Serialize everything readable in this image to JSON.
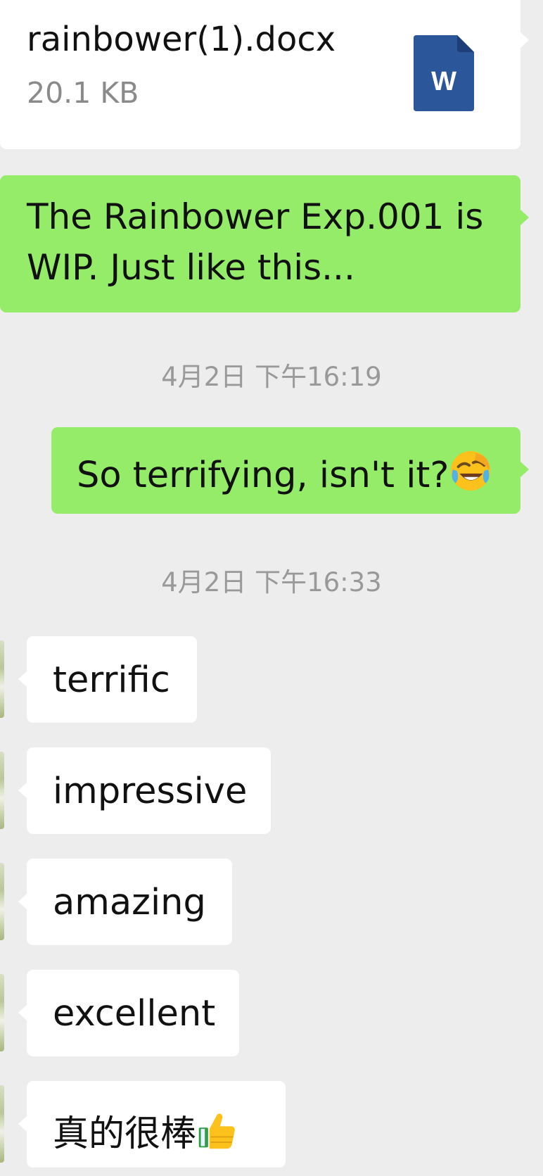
{
  "file_message": {
    "file_name": "rainbower(1).docx",
    "file_size": "20.1 KB",
    "icon": "word-document-icon",
    "icon_letter": "W"
  },
  "messages": {
    "rainbower": {
      "line1": "The Rainbower Exp.001 is",
      "line2": "WIP. Just like this..."
    },
    "timestamp_1": "4月2日 下午16:19",
    "terrifying": {
      "text": "So terrifying, isn't it?",
      "emoji": "face-with-tears-of-joy-emoji"
    },
    "timestamp_2": "4月2日 下午16:33",
    "incoming": {
      "terrific": "terrific",
      "impressive": "impressive",
      "amazing": "amazing",
      "excellent": "excellent",
      "zhende": "真的很棒",
      "zhende_emoji": "thumbs-up-emoji"
    }
  },
  "colors": {
    "background": "#ededed",
    "sent_bubble": "#95ec69",
    "received_bubble": "#ffffff",
    "timestamp": "#999999",
    "word_icon": "#2b579a"
  }
}
